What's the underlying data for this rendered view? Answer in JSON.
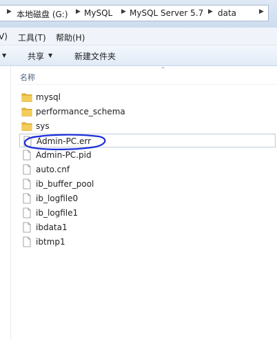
{
  "address_bar": {
    "crumbs": [
      "本地磁盘 (G:)",
      "MySQL",
      "MySQL Server 5.7",
      "data"
    ]
  },
  "menu_bar": {
    "items": [
      "V)",
      "工具(T)",
      "帮助(H)"
    ]
  },
  "command_bar": {
    "share_label": "共享",
    "new_folder_label": "新建文件夹"
  },
  "file_list": {
    "column_name": "名称",
    "items": [
      {
        "name": "mysql",
        "type": "folder"
      },
      {
        "name": "performance_schema",
        "type": "folder"
      },
      {
        "name": "sys",
        "type": "folder"
      },
      {
        "name": "Admin-PC.err",
        "type": "file",
        "selected": true
      },
      {
        "name": "Admin-PC.pid",
        "type": "file"
      },
      {
        "name": "auto.cnf",
        "type": "file"
      },
      {
        "name": "ib_buffer_pool",
        "type": "file"
      },
      {
        "name": "ib_logfile0",
        "type": "file"
      },
      {
        "name": "ib_logfile1",
        "type": "file"
      },
      {
        "name": "ibdata1",
        "type": "file"
      },
      {
        "name": "ibtmp1",
        "type": "file"
      }
    ]
  },
  "annotation": {
    "color": "#1a2fd8",
    "shape": "hand-drawn ellipse around selected file"
  },
  "colors": {
    "folder": "#e8b939",
    "selection_border": "#bcc9dc",
    "header_text": "#4c607a"
  }
}
